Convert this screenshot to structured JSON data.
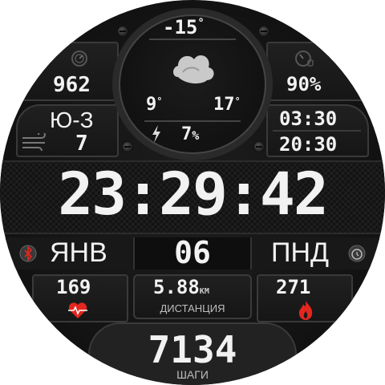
{
  "weather": {
    "current_temp": "-15",
    "current_temp_unit": "°",
    "low_temp": "9",
    "low_temp_unit": "°",
    "high_temp": "17",
    "high_temp_unit": "°",
    "precipitation": "7",
    "precipitation_unit": "%",
    "condition_icon": "cloud-icon"
  },
  "left_top": {
    "pressure": "962",
    "icon": "barometer-icon"
  },
  "right_top": {
    "humidity": "90%",
    "icon": "humidity-gauge-icon"
  },
  "wind": {
    "direction": "Ю-З",
    "speed": "7",
    "icon": "wind-icon"
  },
  "sun": {
    "sunrise": "03:30",
    "sunset": "20:30"
  },
  "time": {
    "display": "23:29:42"
  },
  "date": {
    "month": "ЯНВ",
    "day": "06",
    "weekday": "ПНД"
  },
  "stats": {
    "heart_rate": "169",
    "distance_value": "5.88",
    "distance_unit": "KM",
    "distance_label": "ДИСТАНЦИЯ",
    "calories": "271"
  },
  "steps": {
    "count": "7134",
    "label": "ШАГИ"
  },
  "colors": {
    "accent_red": "#e2271f",
    "text": "#f2f2f2",
    "bezel": "#3a3a3a"
  }
}
